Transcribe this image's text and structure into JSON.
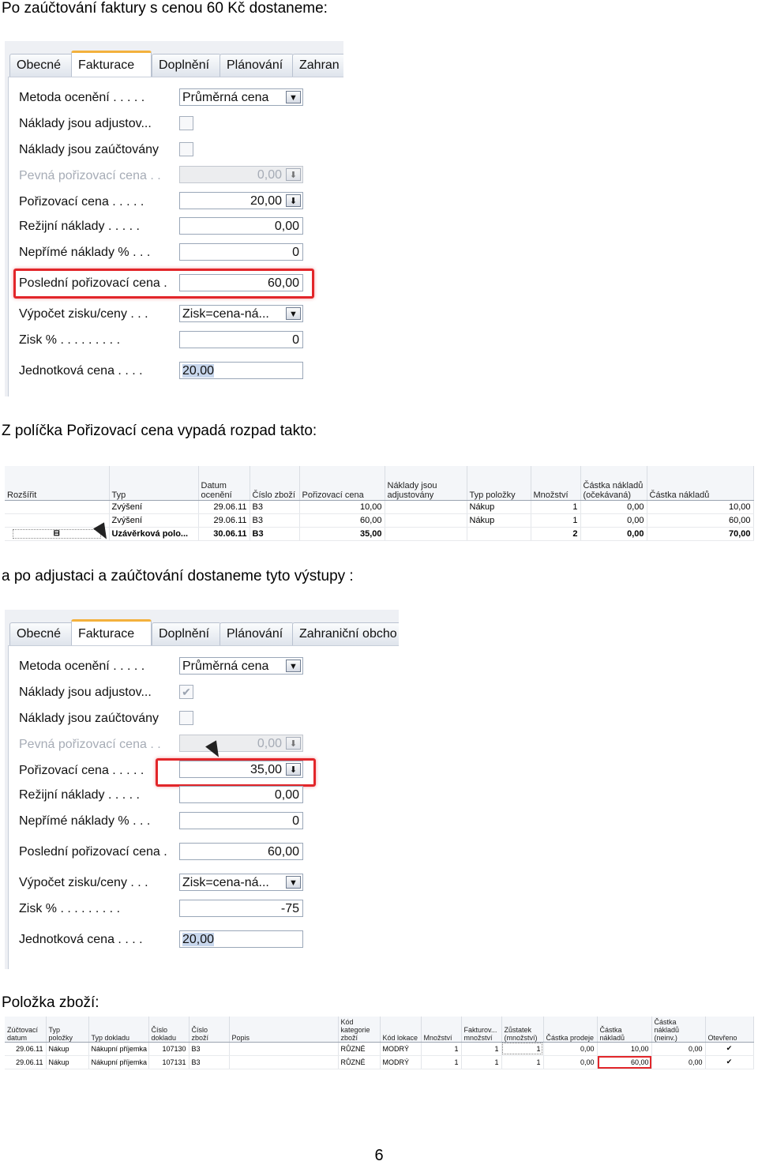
{
  "headings": {
    "h1": "Po zaúčtování faktury s cenou 60 Kč  dostaneme:",
    "h2": "Z políčka Pořizovací cena vypadá rozpad takto:",
    "h3": "a po adjustaci a zaúčtování dostaneme tyto výstupy :",
    "h4": "Položka zboží:"
  },
  "card1": {
    "tabs": [
      "Obecné",
      "Fakturace",
      "Doplnění",
      "Plánování",
      "Zahran"
    ],
    "rows": [
      {
        "label": "Metoda ocenění . . . . .",
        "value": "Průměrná cena"
      },
      {
        "label": "Náklady jsou adjustov..."
      },
      {
        "label": "Náklady jsou zaúčtovány"
      },
      {
        "label": "Pevná pořizovací cena . .",
        "value": "0,00"
      },
      {
        "label": "Pořizovací cena . . . . .",
        "value": "20,00"
      },
      {
        "label": "Režijní náklady . . . . .",
        "value": "0,00"
      },
      {
        "label": "Nepřímé náklady % . . .",
        "value": "0"
      },
      {
        "label": "Poslední pořizovací cena .",
        "value": "60,00"
      },
      {
        "label": "Výpočet zisku/ceny . . .",
        "value": "Zisk=cena-ná..."
      },
      {
        "label": "Zisk % . . . . . . . . .",
        "value": "0"
      },
      {
        "label": "Jednotková cena . . . .",
        "value": "20,00"
      }
    ]
  },
  "card2": {
    "tabs": [
      "Obecné",
      "Fakturace",
      "Doplnění",
      "Plánování",
      "Zahraniční obcho"
    ],
    "rows": [
      {
        "label": "Metoda ocenění . . . . .",
        "value": "Průměrná cena"
      },
      {
        "label": "Náklady jsou adjustov...",
        "checked": "✔"
      },
      {
        "label": "Náklady jsou zaúčtovány"
      },
      {
        "label": "Pevná pořizovací cena . .",
        "value": "0,00"
      },
      {
        "label": "Pořizovací cena . . . . .",
        "value": "35,00"
      },
      {
        "label": "Režijní náklady . . . . .",
        "value": "0,00"
      },
      {
        "label": "Nepřímé náklady % . . .",
        "value": "0"
      },
      {
        "label": "Poslední pořizovací cena .",
        "value": "60,00"
      },
      {
        "label": "Výpočet zisku/ceny . . .",
        "value": "Zisk=cena-ná..."
      },
      {
        "label": "Zisk % . . . . . . . . .",
        "value": "-75"
      },
      {
        "label": "Jednotková cena . . . .",
        "value": "20,00"
      }
    ]
  },
  "icons": {
    "dropdown": "▼",
    "lookup": "⬇",
    "collapse": "⊟"
  },
  "breakdown": {
    "headers": [
      "Rozšířit",
      "Typ",
      "Datum ocenění",
      "Číslo zboží",
      "Pořizovací cena",
      "Náklady jsou adjustovány",
      "Typ položky",
      "Množství",
      "Částka nákladů (očekávaná)",
      "Částka nákladů"
    ],
    "rows": [
      [
        "",
        "Zvýšení",
        "29.06.11",
        "B3",
        "10,00",
        "",
        "Nákup",
        "1",
        "0,00",
        "10,00"
      ],
      [
        "",
        "Zvýšení",
        "29.06.11",
        "B3",
        "60,00",
        "",
        "Nákup",
        "1",
        "0,00",
        "60,00"
      ],
      [
        "",
        "Uzávěrková polo...",
        "30.06.11",
        "B3",
        "35,00",
        "",
        "",
        "2",
        "0,00",
        "70,00"
      ]
    ]
  },
  "items": {
    "headers": [
      "Zúčtovací datum",
      "Typ položky",
      "Typ dokladu",
      "Číslo dokladu",
      "Číslo zboží",
      "Popis",
      "Kód kategorie zboží",
      "Kód lokace",
      "Množství",
      "Fakturov... množství",
      "Zůstatek (množství)",
      "Částka prodeje",
      "Částka nákladů",
      "Částka nákladů (neinv.)",
      "Otevřeno"
    ],
    "rows": [
      [
        "29.06.11",
        "Nákup",
        "Nákupní příjemka",
        "107130",
        "B3",
        "",
        "RŮZNÉ",
        "MODRÝ",
        "1",
        "1",
        "1",
        "0,00",
        "10,00",
        "0,00",
        "✔"
      ],
      [
        "29.06.11",
        "Nákup",
        "Nákupní příjemka",
        "107131",
        "B3",
        "",
        "RŮZNÉ",
        "MODRÝ",
        "1",
        "1",
        "1",
        "0,00",
        "60,00",
        "0,00",
        "✔"
      ]
    ]
  },
  "page_number": "6"
}
